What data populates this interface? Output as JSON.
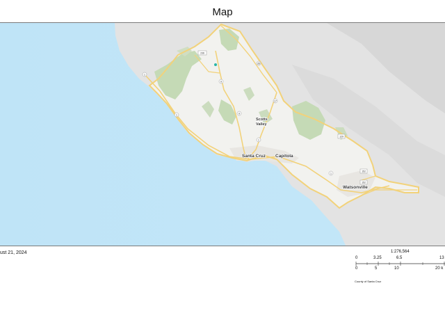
{
  "map_title": "Map",
  "date_text": "ust 21, 2024",
  "scale": {
    "ratio": "1:276,564",
    "upper_ticks": [
      "0",
      "3.25",
      "6.5",
      "13"
    ],
    "lower_ticks": [
      "0",
      "5",
      "10",
      "20 k"
    ]
  },
  "credit": "County of Santa Cruz",
  "places": {
    "santa_cruz": "Santa Cruz",
    "capitola": "Capitola",
    "scotts": "Scotts",
    "valley": "Valley",
    "watsonville": "Watsonville"
  },
  "highways": [
    "1",
    "9",
    "17",
    "35",
    "236",
    "129",
    "152",
    "1",
    "9",
    "1",
    "1",
    "152"
  ],
  "colors": {
    "ocean": "#bfe4f7",
    "land": "#e6e6e6",
    "county": "#f3f3f1",
    "forest": "#c9dcba",
    "boundary": "#f2d27a"
  }
}
